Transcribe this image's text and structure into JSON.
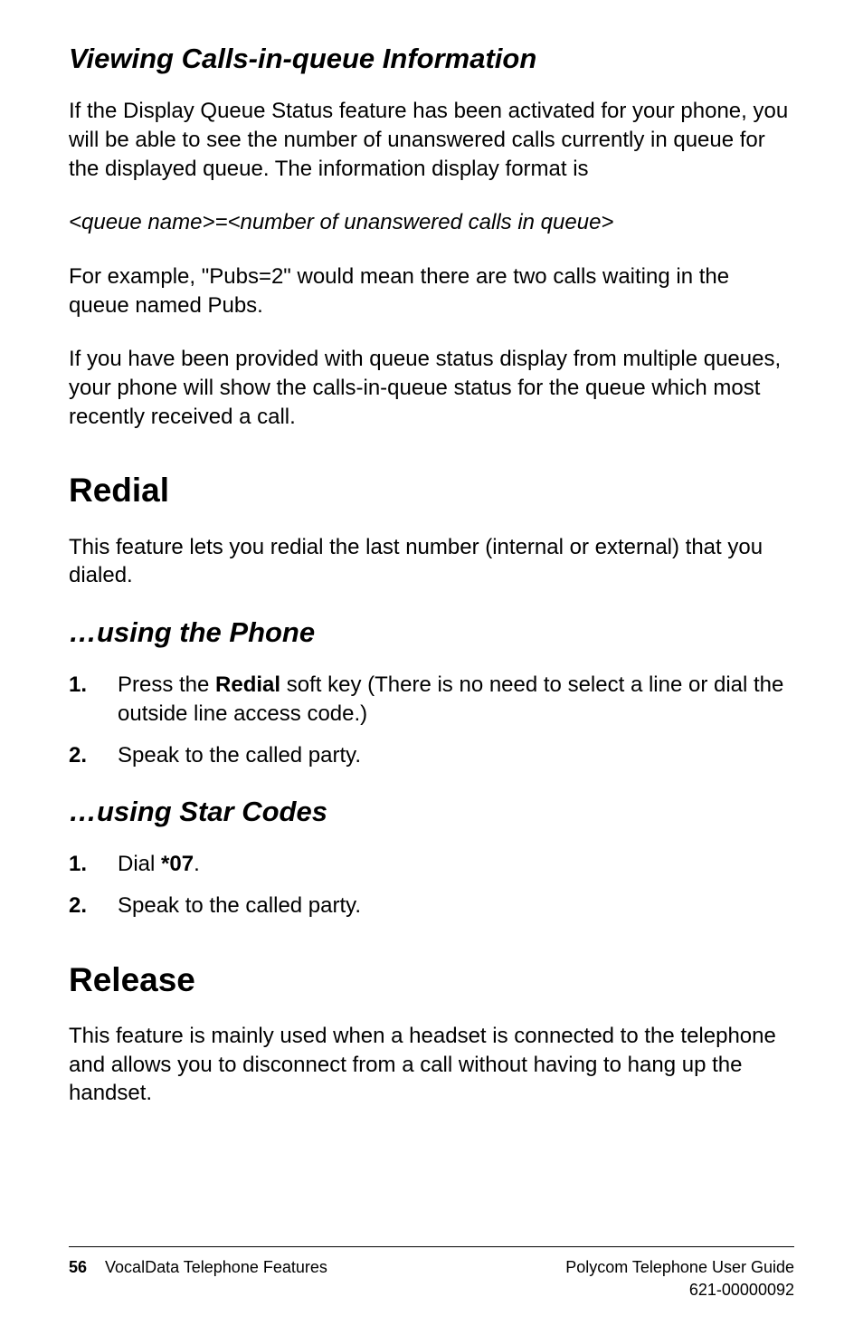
{
  "section1": {
    "title": "Viewing Calls-in-queue Information",
    "para1": "If the Display Queue Status feature has been activated for your phone, you will be able to see the number of unanswered calls currently in queue for the displayed queue. The information display format is",
    "format_line": "<queue name>=<number of unanswered calls in queue>",
    "para2": "For example, \"Pubs=2\" would mean there are two calls waiting in the queue named Pubs.",
    "para3": "If you have been provided with queue status display from multiple queues, your phone will show the calls-in-queue status for the queue which most recently received a call."
  },
  "redial": {
    "title": "Redial",
    "intro": "This feature lets you redial the last number (internal or external) that you dialed.",
    "phone": {
      "title": "…using the Phone",
      "items": [
        {
          "num": "1.",
          "pre": "Press the ",
          "bold": "Redial",
          "post": " soft key (There is no need to select a line or dial the outside line access code.)"
        },
        {
          "num": "2.",
          "pre": "Speak to the called party.",
          "bold": "",
          "post": ""
        }
      ]
    },
    "star": {
      "title": "…using Star Codes",
      "items": [
        {
          "num": "1.",
          "pre": "Dial ",
          "bold": "*07",
          "post": "."
        },
        {
          "num": "2.",
          "pre": "Speak to the called party.",
          "bold": "",
          "post": ""
        }
      ]
    }
  },
  "release": {
    "title": "Release",
    "intro": "This feature is mainly used when a headset is connected to the telephone and allows you to disconnect from a call without having to hang up the handset."
  },
  "footer": {
    "page": "56",
    "left": "VocalData Telephone Features",
    "right1": "Polycom Telephone User Guide",
    "right2": "621-00000092"
  }
}
